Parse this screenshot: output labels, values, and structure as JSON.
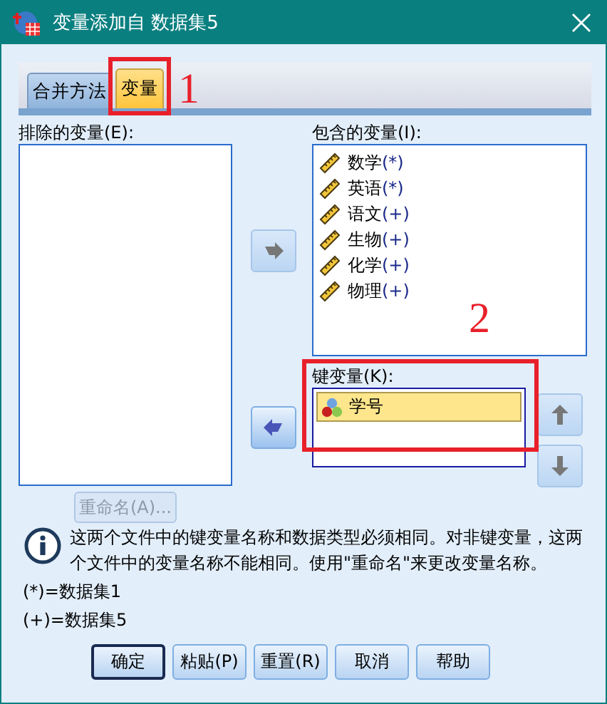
{
  "window": {
    "title": "变量添加自 数据集5"
  },
  "tabs": [
    {
      "label": "合并方法",
      "selected": false,
      "highlighted": false
    },
    {
      "label": "变量",
      "selected": true,
      "highlighted": true
    }
  ],
  "annotations": [
    {
      "number": "1"
    },
    {
      "number": "2"
    }
  ],
  "excluded": {
    "label": "排除的变量(E):"
  },
  "included": {
    "label": "包含的变量(I):",
    "items": [
      {
        "name": "数学",
        "source": "(*)",
        "kind": "scale"
      },
      {
        "name": "英语",
        "source": "(*)",
        "kind": "scale"
      },
      {
        "name": "语文",
        "source": "(+)",
        "kind": "scale"
      },
      {
        "name": "生物",
        "source": "(+)",
        "kind": "scale"
      },
      {
        "name": "化学",
        "source": "(+)",
        "kind": "scale"
      },
      {
        "name": "物理",
        "source": "(+)",
        "kind": "scale"
      }
    ]
  },
  "move_right_button": {
    "disabled": true
  },
  "move_left_button": {
    "disabled": false
  },
  "key_variables": {
    "label": "键变量(K):",
    "highlighted": true,
    "items": [
      {
        "name": "学号",
        "kind": "nominal",
        "selected": true
      }
    ]
  },
  "move_up_button": {
    "disabled": true
  },
  "move_down_button": {
    "disabled": true
  },
  "rename_button": {
    "label": "重命名(A)...",
    "disabled": true
  },
  "info": "这两个文件中的键变量名称和数据类型必须相同。对非键变量，这两个文件中的变量名称不能相同。使用\"重命名\"来更改变量名称。",
  "legend": [
    "(*)=数据集1",
    "(+)=数据集5"
  ],
  "buttons": [
    {
      "label": "确定",
      "default": true
    },
    {
      "label": "粘贴(P)",
      "default": false
    },
    {
      "label": "重置(R)",
      "default": false
    },
    {
      "label": "取消",
      "default": false
    },
    {
      "label": "帮助",
      "default": false
    }
  ]
}
